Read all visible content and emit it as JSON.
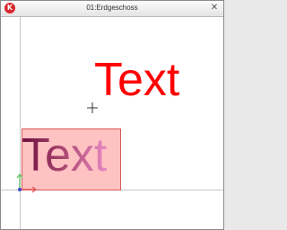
{
  "window": {
    "title": "01:Erdgeschoss",
    "app_icon": "app-logo-icon",
    "close_glyph": "✕"
  },
  "canvas": {
    "red_text": "Text",
    "red_text_color": "#ff0000",
    "selected_text": "Text",
    "selected_text_gradient": [
      "#6f0f40",
      "#a4416a",
      "#e889c2"
    ],
    "selection_color": "#ff7878",
    "crosshair_icon": "crosshair-icon",
    "origin_icon": "origin-axes-icon"
  }
}
